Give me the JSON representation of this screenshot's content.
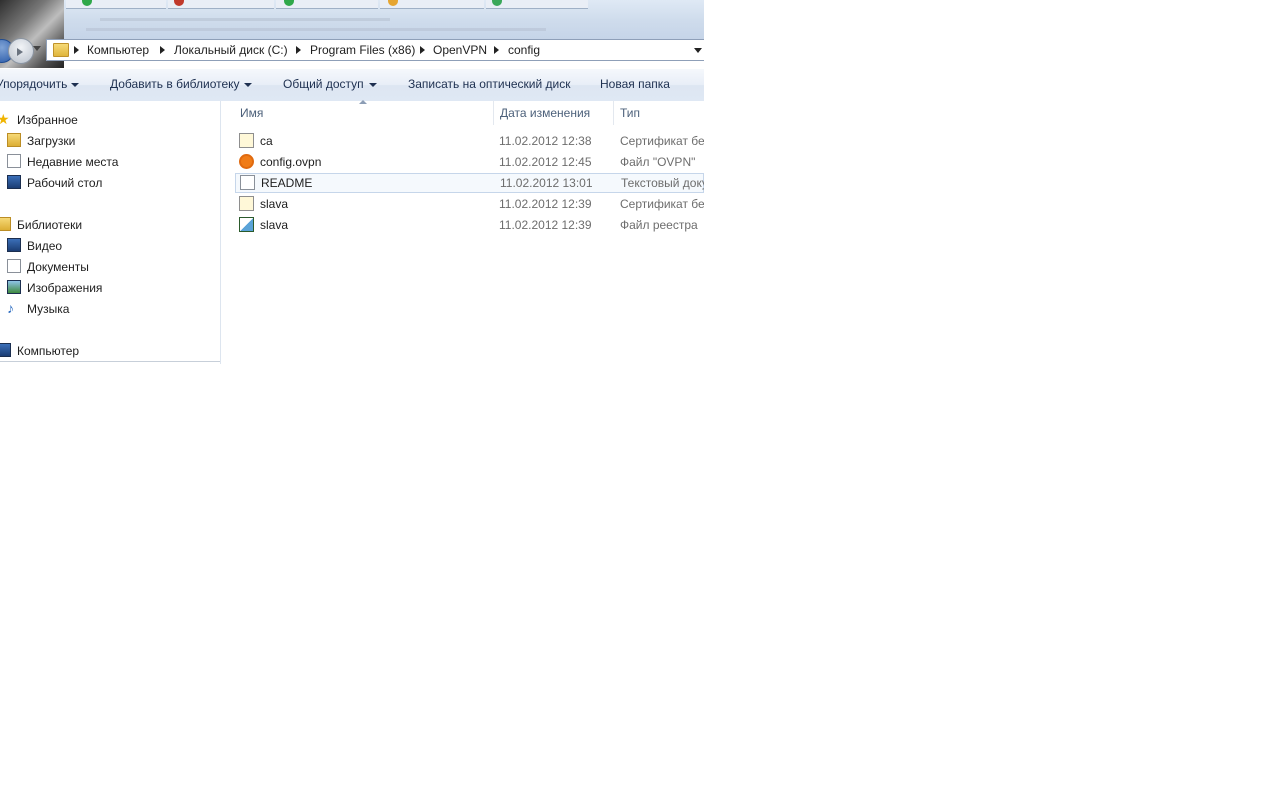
{
  "address_bar": {
    "breadcrumbs": [
      "Компьютер",
      "Локальный диск (C:)",
      "Program Files (x86)",
      "OpenVPN",
      "config"
    ]
  },
  "toolbar": {
    "organize": "Упорядочить",
    "add_to_library": "Добавить в библиотеку",
    "share": "Общий доступ",
    "burn": "Записать на оптический диск",
    "new_folder": "Новая папка"
  },
  "nav_pane": {
    "favorites": {
      "label": "Избранное",
      "items": [
        "Загрузки",
        "Недавние места",
        "Рабочий стол"
      ]
    },
    "libraries": {
      "label": "Библиотеки",
      "items": [
        "Видео",
        "Документы",
        "Изображения",
        "Музыка"
      ]
    },
    "computer": {
      "label": "Компьютер"
    }
  },
  "columns": {
    "name": "Имя",
    "date": "Дата изменения",
    "type": "Тип"
  },
  "files": [
    {
      "name": "ca",
      "date": "11.02.2012 12:38",
      "type": "Сертификат без",
      "icon": "certificate-icon"
    },
    {
      "name": "config.ovpn",
      "date": "11.02.2012 12:45",
      "type": "Файл \"OVPN\"",
      "icon": "openvpn-icon"
    },
    {
      "name": "README",
      "date": "11.02.2012 13:01",
      "type": "Текстовый доку",
      "icon": "text-document-icon"
    },
    {
      "name": "slava",
      "date": "11.02.2012 12:39",
      "type": "Сертификат без",
      "icon": "certificate-icon"
    },
    {
      "name": "slava",
      "date": "11.02.2012 12:39",
      "type": "Файл реестра",
      "icon": "registry-file-icon"
    }
  ],
  "colors": {
    "command_bar_text": "#1e3050",
    "header_text": "#4c607a",
    "selection_border": "#c6d6ea"
  }
}
